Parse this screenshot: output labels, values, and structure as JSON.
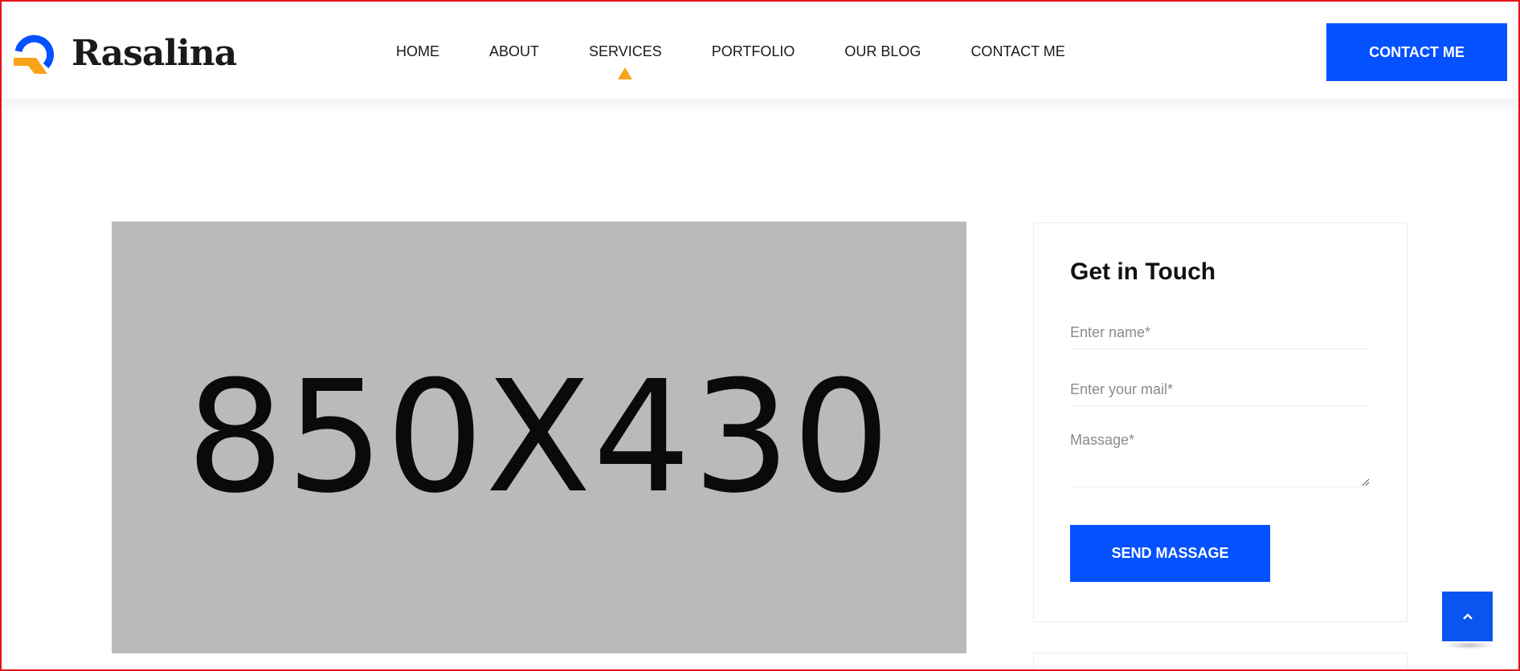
{
  "brand": {
    "name": "Rasalina",
    "logo_colors": {
      "blue": "#0451ff",
      "orange": "#f7a41a"
    }
  },
  "nav": {
    "items": [
      {
        "label": "HOME"
      },
      {
        "label": "ABOUT"
      },
      {
        "label": "SERVICES",
        "active": true
      },
      {
        "label": "PORTFOLIO"
      },
      {
        "label": "OUR BLOG"
      },
      {
        "label": "CONTACT ME"
      }
    ],
    "cta_label": "CONTACT ME"
  },
  "main": {
    "placeholder_text": "850X430"
  },
  "contact_widget": {
    "title": "Get in Touch",
    "name_placeholder": "Enter name*",
    "mail_placeholder": "Enter your mail*",
    "message_placeholder": "Massage*",
    "submit_label": "SEND MASSAGE"
  },
  "scroll_top": {
    "icon": "chevron-up-icon"
  },
  "colors": {
    "accent": "#0451ff",
    "caret": "#f7a41a",
    "placeholder_bg": "#bababa",
    "frame_border": "#e4111b"
  }
}
